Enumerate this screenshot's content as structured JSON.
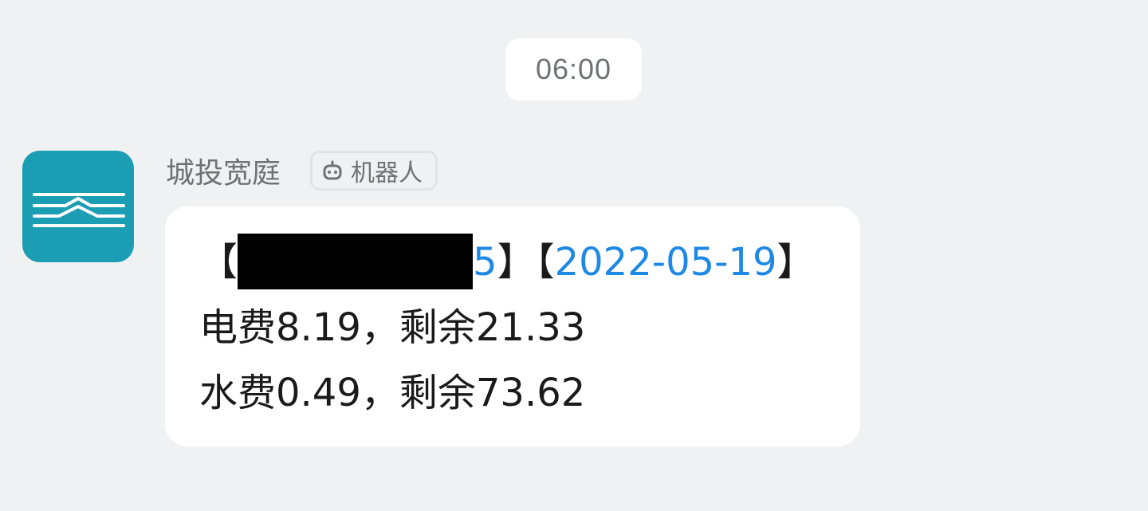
{
  "timestamp": "06:00",
  "sender": {
    "name": "城投宽庭",
    "avatar_color": "#1b9db3",
    "badge_icon": "robot-icon",
    "badge_label": "机器人"
  },
  "message": {
    "line1": {
      "open_bracket_1": "【",
      "room_suffix": "5",
      "close_bracket_1": "】",
      "open_bracket_2": "【",
      "date": "2022-05-19",
      "close_bracket_2": "】"
    },
    "line2": "电费8.19，剩余21.33",
    "line3": "水费0.49，剩余73.62"
  },
  "colors": {
    "background": "#f0f1f3",
    "link": "#1e88e5",
    "muted_text": "#6f7173"
  }
}
